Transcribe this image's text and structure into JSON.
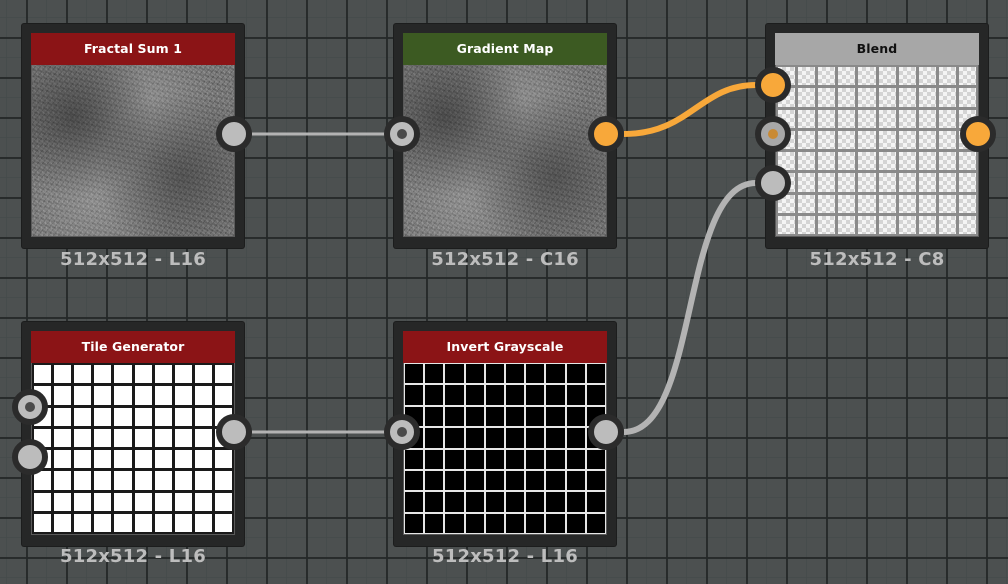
{
  "colors": {
    "header_red": "#8b1416",
    "header_green": "#3c5a22",
    "header_gray": "#a7a7a7",
    "wire_gray": "#b3b3b3",
    "wire_orange": "#f8a83a",
    "port_gray": "#bcbcbc",
    "port_orange": "#f8a83a"
  },
  "nodes": {
    "fractal_sum": {
      "title": "Fractal Sum 1",
      "size": "512x512 - L16"
    },
    "gradient_map": {
      "title": "Gradient Map",
      "size": "512x512 - C16"
    },
    "blend": {
      "title": "Blend",
      "size": "512x512 - C8"
    },
    "tile_generator": {
      "title": "Tile Generator",
      "size": "512x512 - L16"
    },
    "invert_grayscale": {
      "title": "Invert Grayscale",
      "size": "512x512 - L16"
    }
  },
  "connections": [
    {
      "from": "fractal_sum.output",
      "to": "gradient_map.input",
      "color": "gray"
    },
    {
      "from": "gradient_map.output",
      "to": "blend.input_1",
      "color": "orange"
    },
    {
      "from": "tile_generator.output",
      "to": "invert_grayscale.input",
      "color": "gray"
    },
    {
      "from": "invert_grayscale.output",
      "to": "blend.input_3",
      "color": "gray"
    }
  ]
}
